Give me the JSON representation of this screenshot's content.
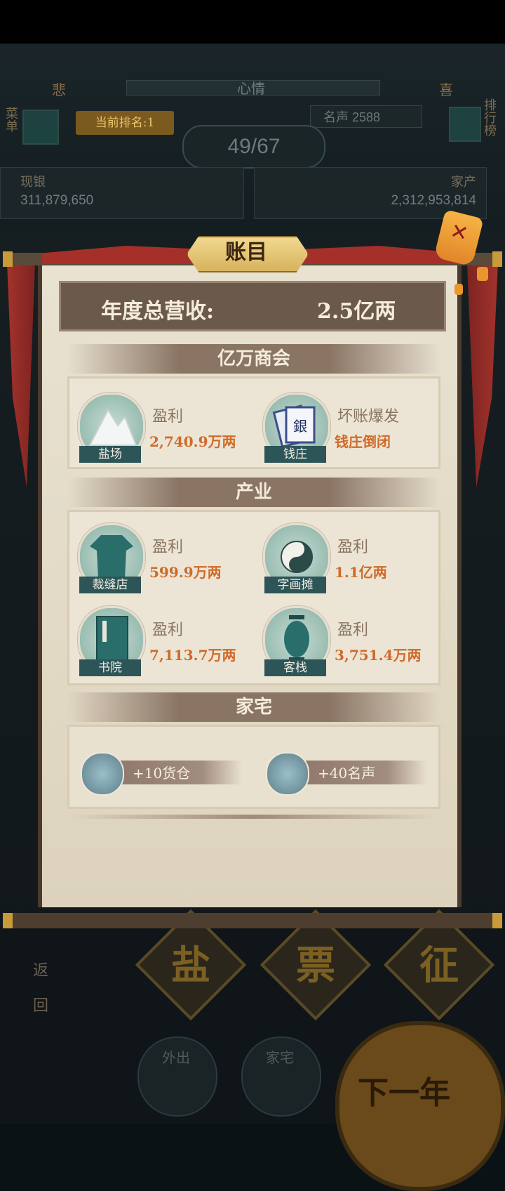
{
  "background": {
    "mood": {
      "sad": "悲",
      "label": "心情",
      "happy": "喜"
    },
    "menu_label": "菜单",
    "rank_badge": "当前排名:1",
    "fame": "名声 2588",
    "leaderboard_label": "排行榜",
    "day_counter": "49/67",
    "silver": {
      "label": "现银",
      "value": "311,879,650"
    },
    "assets": {
      "label": "家产",
      "value": "2,312,953,814"
    },
    "actions": [
      "盐",
      "票",
      "征"
    ],
    "back_label": [
      "返",
      "回"
    ],
    "bottom": {
      "outing": "外出",
      "home": "家宅",
      "next_year": "下一年"
    }
  },
  "modal": {
    "title": "账目",
    "revenue": {
      "label": "年度总营收:",
      "value": "2.5亿两"
    },
    "chamber": {
      "heading": "亿万商会",
      "items": [
        {
          "tag": "盐场",
          "line1": "盈利",
          "line2": "2,740.9万两",
          "icon": "salt-mountain-icon"
        },
        {
          "tag": "钱庄",
          "line1": "坏账爆发",
          "line2": "钱庄倒闭",
          "icon": "banknote-icon"
        }
      ]
    },
    "industry": {
      "heading": "产业",
      "items": [
        {
          "tag": "裁缝店",
          "line1": "盈利",
          "line2": "599.9万两",
          "icon": "robe-icon"
        },
        {
          "tag": "字画摊",
          "line1": "盈利",
          "line2": "1.1亿两",
          "icon": "yin-yang-icon"
        },
        {
          "tag": "书院",
          "line1": "盈利",
          "line2": "7,113.7万两",
          "icon": "book-icon"
        },
        {
          "tag": "客栈",
          "line1": "盈利",
          "line2": "3,751.4万两",
          "icon": "lantern-icon"
        }
      ]
    },
    "residence": {
      "heading": "家宅",
      "items": [
        {
          "text": "+10货仓",
          "icon": "lady-portrait-icon"
        },
        {
          "text": "+40名声",
          "icon": "lady-portrait-icon"
        }
      ]
    }
  },
  "colors": {
    "profit": "#d06a28",
    "tag": "#2d5558",
    "paper": "#e9e2d1"
  }
}
